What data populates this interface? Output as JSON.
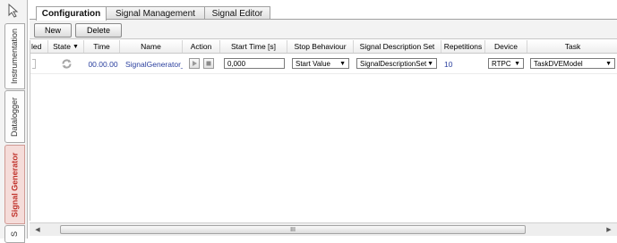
{
  "left_tabs": [
    {
      "label": "Instrumentation"
    },
    {
      "label": "Datalogger"
    },
    {
      "label": "Signal Generator"
    },
    {
      "label": "S"
    }
  ],
  "top_tabs": [
    {
      "label": "Configuration"
    },
    {
      "label": "Signal Management"
    },
    {
      "label": "Signal Editor"
    }
  ],
  "toolbar": {
    "new_label": "New",
    "delete_label": "Delete"
  },
  "table": {
    "headers": {
      "enabled": "led",
      "state": "State",
      "time": "Time",
      "name": "Name",
      "action": "Action",
      "start_time": "Start Time [s]",
      "stop_behaviour": "Stop Behaviour",
      "signal_description_set": "Signal Description Set",
      "repetitions": "Repetitions",
      "device": "Device",
      "task": "Task"
    },
    "row": {
      "time": "00.00.00",
      "name": "SignalGenerator_",
      "start_time": "0,000",
      "stop_behaviour": "Start Value",
      "signal_description_set": "SignalDescriptionSet",
      "repetitions": "10",
      "device": "RTPC",
      "task": "TaskDVEModel"
    }
  },
  "scrollbar": {
    "grip": "III"
  },
  "colors": {
    "active_side_tab": "#c0322b",
    "value_blue": "#2a3f9e"
  }
}
